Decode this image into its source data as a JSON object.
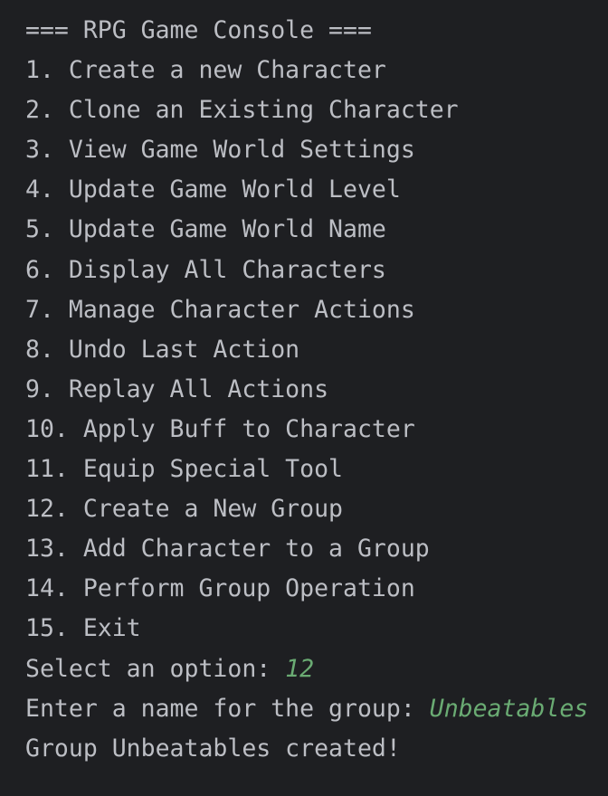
{
  "console": {
    "header": "=== RPG Game Console ===",
    "menu_items": [
      "1. Create a new Character",
      "2. Clone an Existing Character",
      "3. View Game World Settings",
      "4. Update Game World Level",
      "5. Update Game World Name",
      "6. Display All Characters",
      "7. Manage Character Actions",
      "8. Undo Last Action",
      "9. Replay All Actions",
      "10. Apply Buff to Character",
      "11. Equip Special Tool",
      "12. Create a New Group",
      "13. Add Character to a Group",
      "14. Perform Group Operation",
      "15. Exit"
    ],
    "option_prompt": "Select an option: ",
    "option_input": "12",
    "group_prompt": "Enter a name for the group: ",
    "group_input": "Unbeatables",
    "result_message": "Group Unbeatables created!"
  },
  "colors": {
    "background": "#1e1f22",
    "text": "#bcbec4",
    "user_input": "#6aab73"
  }
}
